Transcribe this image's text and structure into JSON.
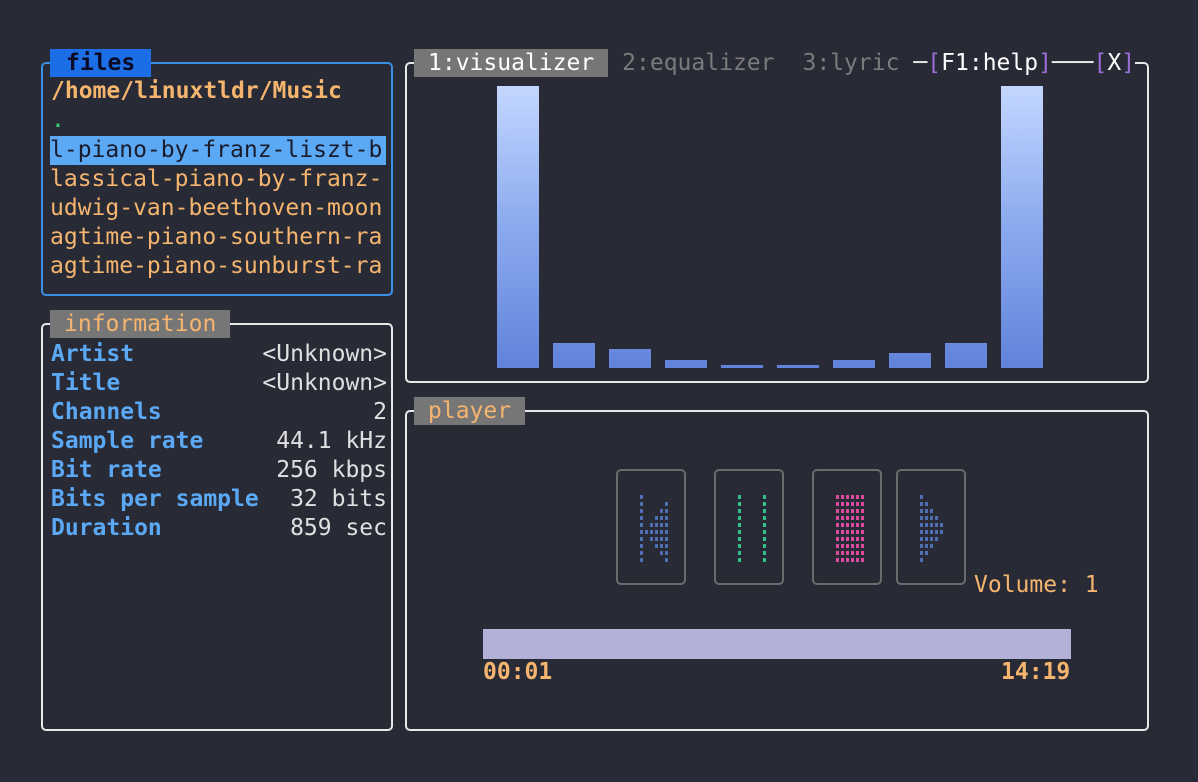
{
  "files": {
    "title": "files",
    "path": "/home/linuxtldr/Music",
    "parent": ".",
    "items": [
      {
        "label": "l-piano-by-franz-liszt-b",
        "selected": true
      },
      {
        "label": "lassical-piano-by-franz-",
        "selected": false
      },
      {
        "label": "udwig-van-beethoven-moon",
        "selected": false
      },
      {
        "label": "agtime-piano-southern-ra",
        "selected": false
      },
      {
        "label": "agtime-piano-sunburst-ra",
        "selected": false
      }
    ]
  },
  "information": {
    "title": "information",
    "rows": [
      {
        "key": "Artist",
        "value": "<Unknown>"
      },
      {
        "key": "Title",
        "value": "<Unknown>"
      },
      {
        "key": "Channels",
        "value": "2"
      },
      {
        "key": "Sample rate",
        "value": "44.1 kHz"
      },
      {
        "key": "Bit rate",
        "value": "256 kbps"
      },
      {
        "key": "Bits per sample",
        "value": "32 bits"
      },
      {
        "key": "Duration",
        "value": "859 sec"
      }
    ]
  },
  "tabs": [
    {
      "label": "1:visualizer",
      "active": true
    },
    {
      "label": "2:equalizer",
      "active": false
    },
    {
      "label": "3:lyric",
      "active": false
    }
  ],
  "help": {
    "label": "F1:help",
    "close": "X"
  },
  "visualizer": {
    "levels": [
      1.0,
      0.09,
      0.066,
      0.028,
      0.012,
      0.012,
      0.028,
      0.052,
      0.09,
      1.0
    ]
  },
  "player": {
    "title": "player",
    "controls": [
      {
        "name": "previous",
        "icon": "previous-track-icon",
        "color": "#4e6fb2"
      },
      {
        "name": "pause",
        "icon": "pause-icon",
        "color": "#2fc486"
      },
      {
        "name": "stop",
        "icon": "stop-icon",
        "color": "#dd4aa0"
      },
      {
        "name": "play",
        "icon": "play-icon",
        "color": "#4e6fb2"
      }
    ],
    "volume": "Volume: 1",
    "elapsed": "00:01",
    "total": "14:19",
    "progress": 1.0
  }
}
